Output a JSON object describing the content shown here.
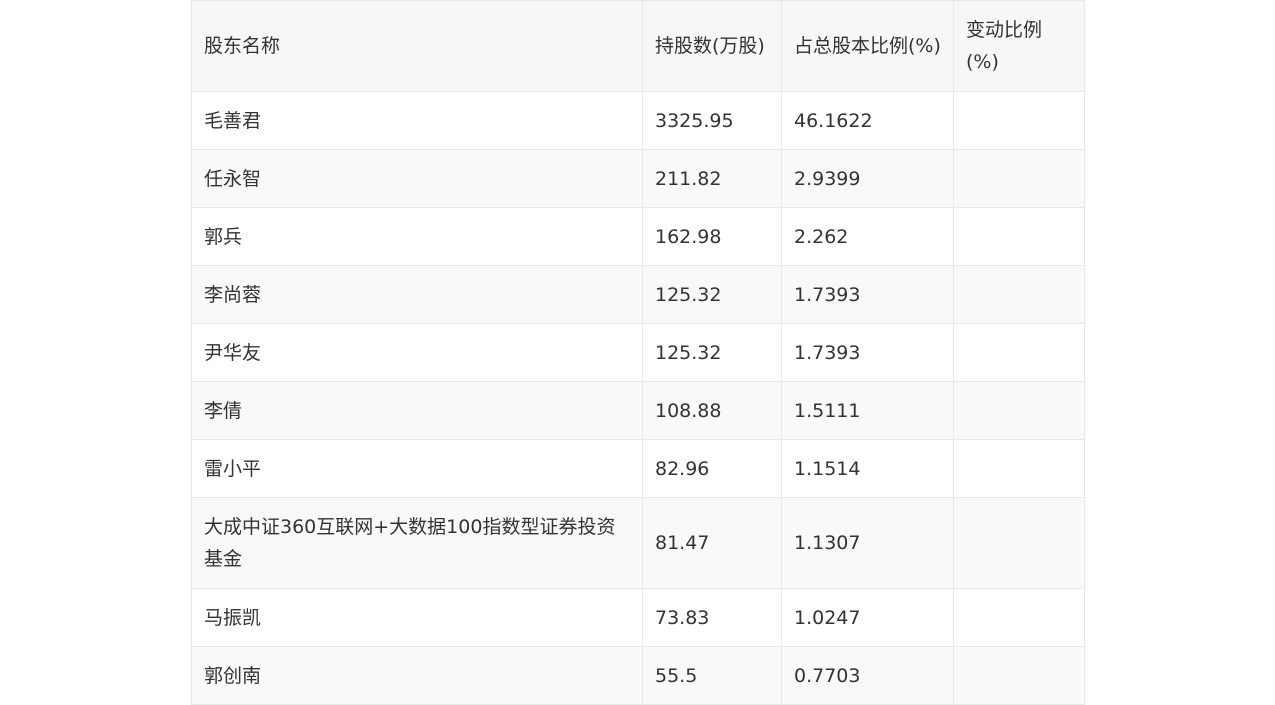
{
  "table": {
    "headers": [
      "股东名称",
      "持股数(万股)",
      "占总股本比例(%)",
      "变动比例(%)"
    ],
    "rows": [
      {
        "name": "毛善君",
        "shares": "3325.95",
        "ratio": "46.1622",
        "change": ""
      },
      {
        "name": "任永智",
        "shares": "211.82",
        "ratio": "2.9399",
        "change": ""
      },
      {
        "name": "郭兵",
        "shares": "162.98",
        "ratio": "2.262",
        "change": ""
      },
      {
        "name": "李尚蓉",
        "shares": "125.32",
        "ratio": "1.7393",
        "change": ""
      },
      {
        "name": "尹华友",
        "shares": "125.32",
        "ratio": "1.7393",
        "change": ""
      },
      {
        "name": "李倩",
        "shares": "108.88",
        "ratio": "1.5111",
        "change": ""
      },
      {
        "name": "雷小平",
        "shares": "82.96",
        "ratio": "1.1514",
        "change": ""
      },
      {
        "name": "大成中证360互联网+大数据100指数型证券投资基金",
        "shares": "81.47",
        "ratio": "1.1307",
        "change": ""
      },
      {
        "name": "马振凯",
        "shares": "73.83",
        "ratio": "1.0247",
        "change": ""
      },
      {
        "name": "郭创南",
        "shares": "55.5",
        "ratio": "0.7703",
        "change": ""
      }
    ]
  }
}
